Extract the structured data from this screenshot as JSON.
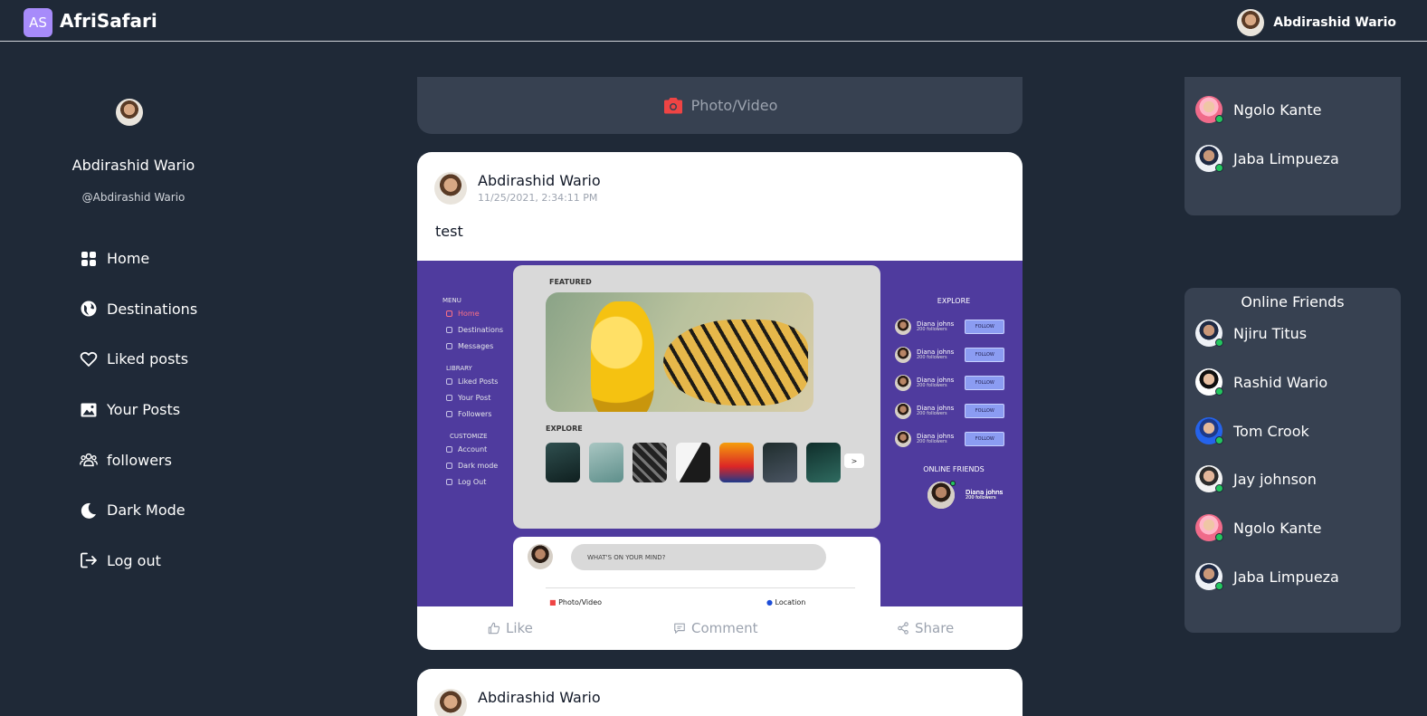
{
  "header": {
    "logo_initials": "AS",
    "brand": "AfriSafari",
    "user_name": "Abdirashid Wario"
  },
  "sidebar": {
    "profile_name": "Abdirashid Wario",
    "profile_handle": "@Abdirashid Wario",
    "items": [
      {
        "label": "Home",
        "icon": "grid-icon"
      },
      {
        "label": "Destinations",
        "icon": "globe-icon"
      },
      {
        "label": "Liked posts",
        "icon": "heart-icon"
      },
      {
        "label": "Your Posts",
        "icon": "image-icon"
      },
      {
        "label": "followers",
        "icon": "users-icon"
      },
      {
        "label": "Dark Mode",
        "icon": "moon-icon"
      },
      {
        "label": "Log out",
        "icon": "logout-icon"
      }
    ]
  },
  "composer": {
    "photo_video_label": "Photo/Video",
    "accent": "#ef4444"
  },
  "posts": [
    {
      "author": "Abdirashid Wario",
      "date": "11/25/2021, 2:34:11 PM",
      "text": "test",
      "actions": {
        "like": "Like",
        "comment": "Comment",
        "share": "Share"
      },
      "embedded": {
        "menu_label": "MENU",
        "menu_items": [
          "Home",
          "Destinations",
          "Messages"
        ],
        "library_label": "LIBRARY",
        "library_items": [
          "Liked Posts",
          "Your Post",
          "Followers"
        ],
        "customize_label": "CUSTOMIZE",
        "customize_items": [
          "Account",
          "Dark mode",
          "Log Out"
        ],
        "featured_label": "FEATURED",
        "explore_label": "EXPLORE",
        "next_label": ">",
        "mind_placeholder": "WHAT'S ON YOUR MIND?",
        "photo_video": "Photo/Video",
        "location": "Location",
        "right_explore_label": "EXPLORE",
        "follow_label": "FOLLOW",
        "online_friends_label": "ONLINE FRIENDS",
        "suggest_name": "Diana johns",
        "suggest_followers": "200 followers"
      }
    },
    {
      "author": "Abdirashid Wario"
    }
  ],
  "right": {
    "top_friends": [
      "Ngolo Kante",
      "Jaba Limpueza"
    ],
    "online_title": "Online Friends",
    "online_friends": [
      "Njiru Titus",
      "Rashid Wario",
      "Tom Crook",
      "Jay johnson",
      "Ngolo Kante",
      "Jaba Limpueza"
    ]
  }
}
